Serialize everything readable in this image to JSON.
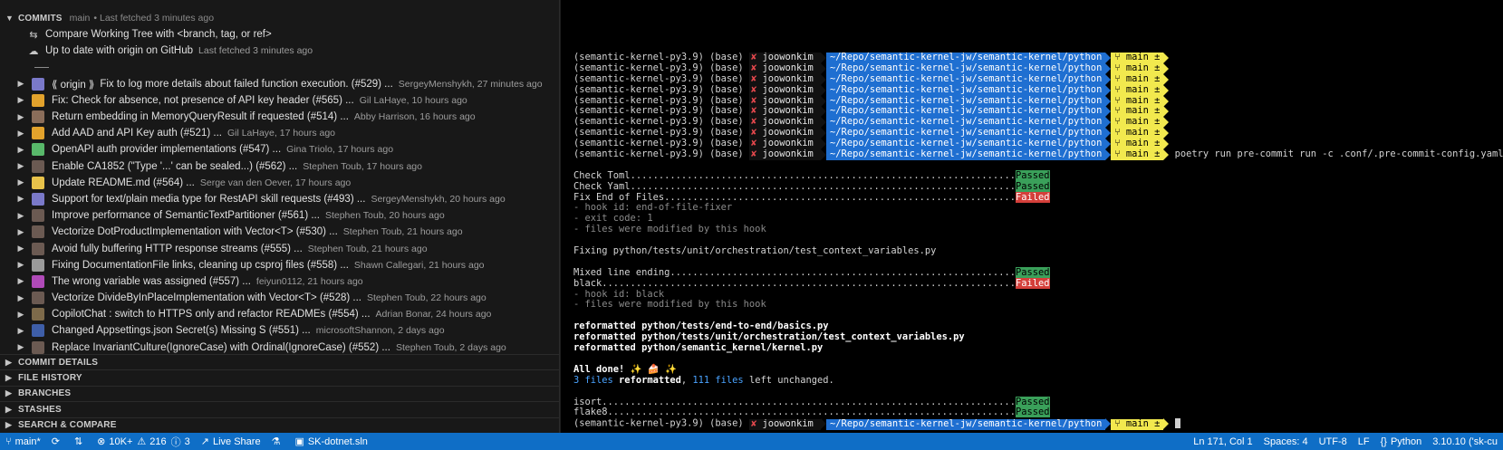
{
  "sidebar": {
    "commits_header": {
      "title": "COMMITS",
      "branch": "main",
      "meta": "Last fetched 3 minutes ago"
    },
    "actions": [
      {
        "icon": "compare-icon",
        "label": "Compare Working Tree with <branch, tag, or ref>",
        "desc": ""
      },
      {
        "icon": "cloud-icon",
        "label": "Up to date with origin on GitHub",
        "desc": "Last fetched 3 minutes ago"
      }
    ],
    "origin_badge": "⟪ origin ⟫",
    "commits": [
      {
        "msg": "Fix to log more details about failed function execution. (#529) ...",
        "desc": "SergeyMenshykh, 27 minutes ago",
        "color": "#7a79c9",
        "origin": true
      },
      {
        "msg": "Fix: Check for absence, not presence of API key header (#565) ...",
        "desc": "Gil LaHaye, 10 hours ago",
        "color": "#e2a22c"
      },
      {
        "msg": "Return embedding in MemoryQueryResult if requested (#514) ...",
        "desc": "Abby Harrison, 16 hours ago",
        "color": "#8a6d5a"
      },
      {
        "msg": "Add AAD and API Key auth (#521) ...",
        "desc": "Gil LaHaye, 17 hours ago",
        "color": "#e2a22c"
      },
      {
        "msg": "OpenAPI auth provider implementations (#547) ...",
        "desc": "Gina Triolo, 17 hours ago",
        "color": "#58b86a"
      },
      {
        "msg": "Enable CA1852 (\"Type '...' can be sealed...) (#562) ...",
        "desc": "Stephen Toub, 17 hours ago",
        "color": "#6b5a52"
      },
      {
        "msg": "Update README.md (#564) ...",
        "desc": "Serge van den Oever, 17 hours ago",
        "color": "#e8c24a"
      },
      {
        "msg": "Support for text/plain media type for RestAPI skill requests (#493) ...",
        "desc": "SergeyMenshykh, 20 hours ago",
        "color": "#7a79c9"
      },
      {
        "msg": "Improve performance of SemanticTextPartitioner (#561) ...",
        "desc": "Stephen Toub, 20 hours ago",
        "color": "#6b5a52"
      },
      {
        "msg": "Vectorize DotProductImplementation with Vector<T> (#530) ...",
        "desc": "Stephen Toub, 21 hours ago",
        "color": "#6b5a52"
      },
      {
        "msg": "Avoid fully buffering HTTP response streams (#555) ...",
        "desc": "Stephen Toub, 21 hours ago",
        "color": "#6b5a52"
      },
      {
        "msg": "Fixing DocumentationFile links, cleaning up csproj files (#558) ...",
        "desc": "Shawn Callegari, 21 hours ago",
        "color": "#9a9a9a"
      },
      {
        "msg": "The wrong variable was assigned (#557) ...",
        "desc": "feiyun0112, 21 hours ago",
        "color": "#b04ab8"
      },
      {
        "msg": "Vectorize DivideByInPlaceImplementation with Vector<T> (#528) ...",
        "desc": "Stephen Toub, 22 hours ago",
        "color": "#6b5a52"
      },
      {
        "msg": "CopilotChat : switch to HTTPS only and refactor READMEs (#554) ...",
        "desc": "Adrian Bonar, 24 hours ago",
        "color": "#7d6a4a"
      },
      {
        "msg": "Changed Appsettings.json Secret(s) Missing S (#551) ...",
        "desc": "microsoftShannon, 2 days ago",
        "color": "#3e5ea8"
      },
      {
        "msg": "Replace InvariantCulture(IgnoreCase) with Ordinal(IgnoreCase) (#552) ...",
        "desc": "Stephen Toub, 2 days ago",
        "color": "#6b5a52"
      }
    ],
    "sections": [
      "COMMIT DETAILS",
      "FILE HISTORY",
      "BRANCHES",
      "STASHES",
      "SEARCH & COMPARE"
    ]
  },
  "terminal": {
    "prompt": {
      "env": "(semantic-kernel-py3.9) (base)",
      "x": "✘",
      "user": "joowonkim",
      "path": "~/Repo/semantic-kernel-jw/semantic-kernel/python",
      "git": " main ±"
    },
    "empty_prompt_count": 9,
    "command": "poetry run pre-commit run -c .conf/.pre-commit-config.yaml -a",
    "output": [
      {
        "t": "blank"
      },
      {
        "t": "check",
        "label": "Check Toml",
        "dots": "....................................................................",
        "status": "Passed"
      },
      {
        "t": "check",
        "label": "Check Yaml",
        "dots": "....................................................................",
        "status": "Passed"
      },
      {
        "t": "check",
        "label": "Fix End of Files",
        "dots": "..............................................................",
        "status": "Failed"
      },
      {
        "t": "dim",
        "text": "- hook id: end-of-file-fixer"
      },
      {
        "t": "dim",
        "text": "- exit code: 1"
      },
      {
        "t": "dim",
        "text": "- files were modified by this hook"
      },
      {
        "t": "blank"
      },
      {
        "t": "plain",
        "text": "Fixing python/tests/unit/orchestration/test_context_variables.py"
      },
      {
        "t": "blank"
      },
      {
        "t": "check",
        "label": "Mixed line ending",
        "dots": ".............................................................",
        "status": "Passed"
      },
      {
        "t": "check",
        "label": "black",
        "dots": ".........................................................................",
        "status": "Failed"
      },
      {
        "t": "dim",
        "text": "- hook id: black"
      },
      {
        "t": "dim",
        "text": "- files were modified by this hook"
      },
      {
        "t": "blank"
      },
      {
        "t": "bold",
        "text": "reformatted python/tests/end-to-end/basics.py"
      },
      {
        "t": "bold",
        "text": "reformatted python/tests/unit/orchestration/test_context_variables.py"
      },
      {
        "t": "bold",
        "text": "reformatted python/semantic_kernel/kernel.py"
      },
      {
        "t": "blank"
      },
      {
        "t": "bold",
        "text": "All done! ✨ 🍰 ✨"
      },
      {
        "t": "summary",
        "a": "3 files",
        "b": " reformatted",
        "c": ", ",
        "d": "111 files",
        "e": " left unchanged."
      },
      {
        "t": "blank"
      },
      {
        "t": "check",
        "label": "isort",
        "dots": ".........................................................................",
        "status": "Passed"
      },
      {
        "t": "check",
        "label": "flake8",
        "dots": "........................................................................",
        "status": "Passed"
      }
    ]
  },
  "statusbar": {
    "branch": "main*",
    "sync_icon": "sync-icon",
    "problems_errors": "10K+",
    "problems_warnings": "216",
    "info": "3",
    "live_share": "Live Share",
    "solution": "SK-dotnet.sln",
    "position": "Ln 171, Col 1",
    "spaces": "Spaces: 4",
    "encoding": "UTF-8",
    "eol": "LF",
    "language": "Python",
    "interpreter": "3.10.10 ('sk-cu"
  }
}
